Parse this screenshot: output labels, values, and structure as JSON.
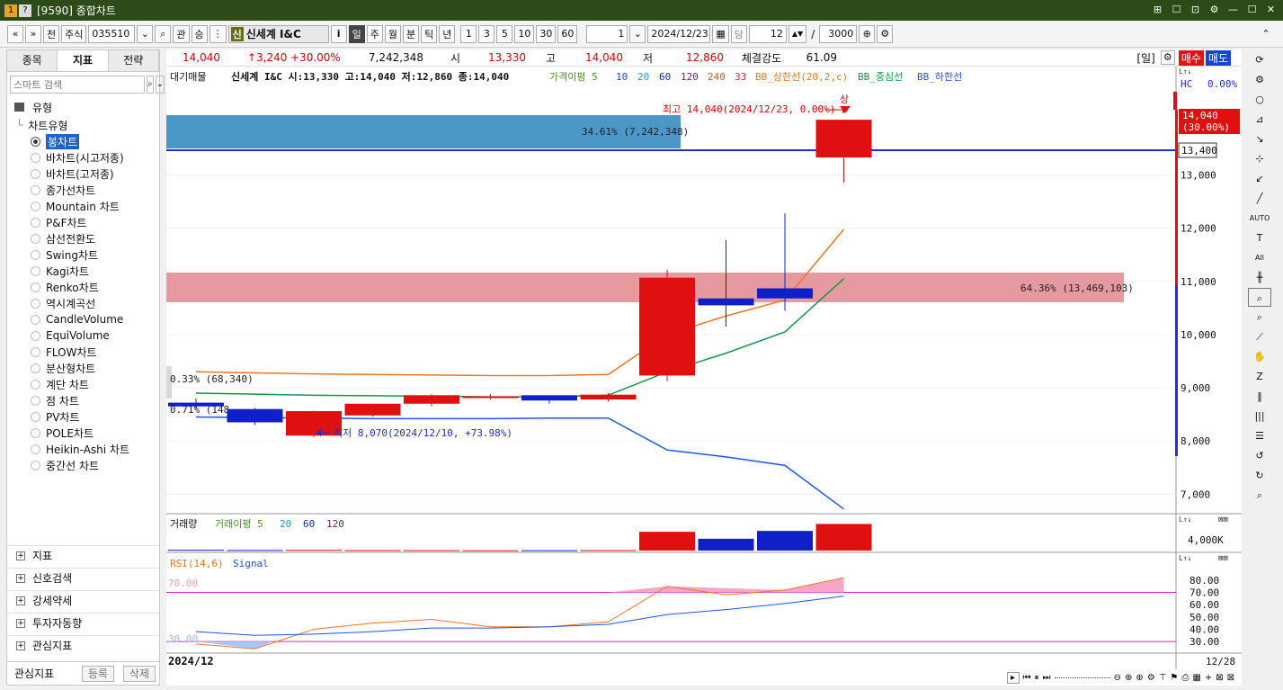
{
  "window": {
    "icon_a": "1",
    "icon_b": "?",
    "title": "[9590] 종합차트",
    "controls": [
      "⊞",
      "☐",
      "⊡",
      "⚙",
      "—",
      "☐",
      "✕"
    ]
  },
  "toolbar": {
    "nav_prev": "«",
    "nav_down": "»",
    "btn_jeon": "전",
    "market_select": "주식",
    "code_input": "035510",
    "btn_gwan": "관",
    "btn_sang": "승",
    "sin_badge": "신",
    "stock_name": "신세계 I&C",
    "info_btn": "i",
    "periods": [
      "일",
      "주",
      "월",
      "분",
      "틱",
      "년"
    ],
    "period_selected": "일",
    "minute_buttons": [
      "1",
      "3",
      "5",
      "10",
      "30",
      "60"
    ],
    "interval_value": "1",
    "date_value": "2024/12/23",
    "btn_dang": "당",
    "count_value": "12",
    "slash": "/",
    "total_value": "3000"
  },
  "left_panel": {
    "tabs": [
      "종목",
      "지표",
      "전략"
    ],
    "active_tab": "지표",
    "search_placeholder": "스마트 검색",
    "section_type": "유형",
    "chart_type_group": "차트유형",
    "chart_types": [
      "봉차트",
      "바차트(시고저종)",
      "바차트(고저종)",
      "종가선차트",
      "Mountain 차트",
      "P&F차트",
      "삼선전환도",
      "Swing차트",
      "Kagi차트",
      "Renko차트",
      "역시계곡선",
      "CandleVolume",
      "EquiVolume",
      "FLOW차트",
      "분산형차트",
      "계단 차트",
      "점 차트",
      "PV차트",
      "POLE차트",
      "Heikin-Ashi 차트",
      "중간선 차트"
    ],
    "selected_chart_type": "봉차트",
    "lower_sections": [
      "지표",
      "신호검색",
      "강세약세",
      "투자자동향",
      "관심지표"
    ],
    "footer_label": "관심지표",
    "footer_register": "등록",
    "footer_delete": "삭제"
  },
  "infobar": {
    "price": "14,040",
    "change": "↑3,240",
    "change_pct": "+30.00%",
    "volume": "7,242,348",
    "open_label": "시",
    "open": "13,330",
    "high_label": "고",
    "high": "14,040",
    "low_label": "저",
    "low": "12,860",
    "strength_label": "체결강도",
    "strength": "61.09",
    "period_tag": "[일]",
    "buy": "매수",
    "sell": "매도"
  },
  "price_panel": {
    "legend": {
      "large_volume": "대기매물",
      "ohlc": "신세계 I&C 시:13,330 고:14,040 저:12,860 종:14,040",
      "ma_label": "가격이평 5",
      "ma_values": [
        "10",
        "20",
        "60",
        "120",
        "240",
        "33"
      ],
      "bb_upper": "BB_상한선(20,2,c)",
      "bb_mid": "BB_중심선",
      "bb_lower": "BB_하한선"
    },
    "hc_label": "HC",
    "hc_value": "0.00%",
    "limit_label": "상",
    "high_annotation": "최고 14,040(2024/12/23, 0.00%)",
    "low_annotation": "최저 8,070(2024/12/10, +73.98%)",
    "vp_top": "34.61% (7,242,348)",
    "vp_mid": "64.36% (13,469,103)",
    "vp_small1": "0.33% (68,340)",
    "vp_small2": "0.71% (148,",
    "current_price_tag": "14,040",
    "current_pct_tag": "(30.00%)",
    "hline_tag": "13,400",
    "y_ticks": [
      "13,000",
      "12,000",
      "11,000",
      "10,000",
      "9,000",
      "8,000",
      "7,000"
    ]
  },
  "volume_panel": {
    "title": "거래량",
    "ma_label": "거래이평 5",
    "ma_values": [
      "20",
      "60",
      "120"
    ],
    "y_tick": "4,000K"
  },
  "rsi_panel": {
    "title": "RSI(14,6)",
    "signal": "Signal",
    "upper_level": "70.00",
    "lower_level": "30.00",
    "y_ticks": [
      "80.00",
      "70.00",
      "60.00",
      "50.00",
      "40.00",
      "30.00"
    ]
  },
  "x_axis": {
    "month_label": "2024/12",
    "right_label": "12/28"
  },
  "chart_data": {
    "type": "candlestick",
    "candles": [
      {
        "o": 8720,
        "h": 8800,
        "l": 8600,
        "c": 8650
      },
      {
        "o": 8600,
        "h": 8620,
        "l": 8300,
        "c": 8350
      },
      {
        "o": 8100,
        "h": 8570,
        "l": 8070,
        "c": 8560
      },
      {
        "o": 8480,
        "h": 8700,
        "l": 8460,
        "c": 8700
      },
      {
        "o": 8700,
        "h": 8880,
        "l": 8650,
        "c": 8860
      },
      {
        "o": 8820,
        "h": 8880,
        "l": 8780,
        "c": 8840
      },
      {
        "o": 8860,
        "h": 8830,
        "l": 8700,
        "c": 8760
      },
      {
        "o": 8780,
        "h": 8900,
        "l": 8740,
        "c": 8870
      },
      {
        "o": 9230,
        "h": 11220,
        "l": 9120,
        "c": 11070
      },
      {
        "o": 10680,
        "h": 11780,
        "l": 10150,
        "c": 10550
      },
      {
        "o": 10870,
        "h": 12280,
        "l": 10450,
        "c": 10680
      },
      {
        "o": 13330,
        "h": 14040,
        "l": 12860,
        "c": 14040
      }
    ],
    "ylim": [
      6700,
      14600
    ],
    "volume_k": [
      90,
      60,
      80,
      50,
      45,
      30,
      40,
      50,
      2150,
      1350,
      2250,
      3050
    ],
    "rsi": [
      28,
      24,
      40,
      45,
      48,
      42,
      42,
      46,
      75,
      68,
      72,
      82
    ],
    "rsi_signal": [
      38,
      35,
      36,
      38,
      41,
      41,
      42,
      44,
      52,
      56,
      61,
      67
    ],
    "bb_upper": [
      9300,
      9280,
      9260,
      9250,
      9240,
      9230,
      9230,
      9250,
      10000,
      10350,
      10650,
      11980
    ],
    "bb_mid": [
      8900,
      8880,
      8860,
      8850,
      8840,
      8830,
      8830,
      8860,
      9300,
      9650,
      10050,
      11050
    ],
    "bb_lower": [
      8450,
      8440,
      8430,
      8420,
      8420,
      8420,
      8430,
      8430,
      7830,
      7700,
      7540,
      6720
    ]
  }
}
